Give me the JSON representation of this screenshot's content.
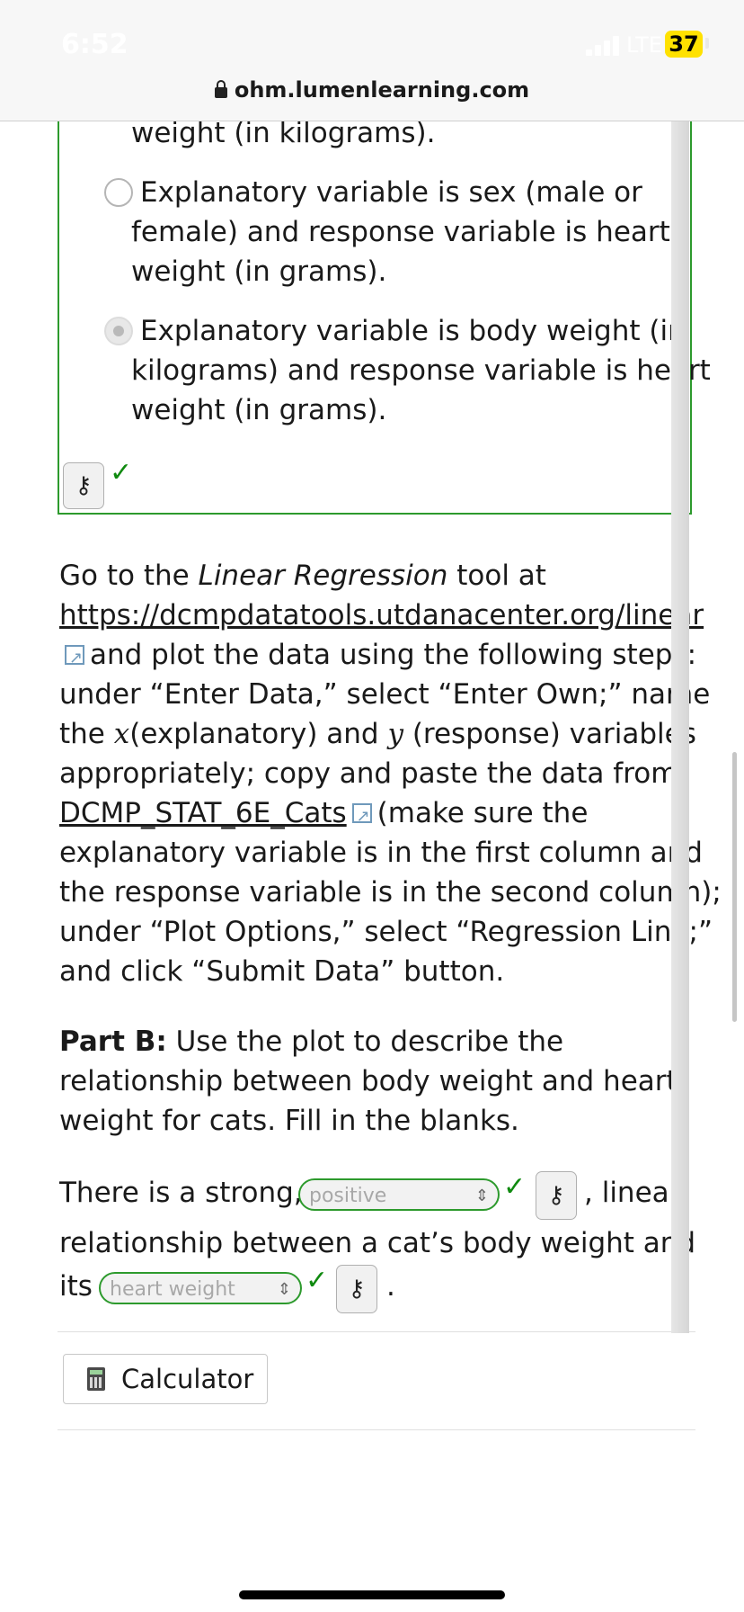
{
  "status_bar": {
    "time": "6:52",
    "network": "LTE",
    "battery": "37"
  },
  "browser": {
    "url": "ohm.lumenlearning.com"
  },
  "question": {
    "prev_option_tail": "weight (in kilograms).",
    "options": [
      {
        "lines": [
          "Explanatory variable is sex (male or",
          "female) and response variable is heart",
          "weight (in grams)."
        ],
        "selected": false
      },
      {
        "lines": [
          "Explanatory variable is body weight (in",
          "kilograms) and response variable is heart",
          "weight (in grams)."
        ],
        "selected": true
      }
    ],
    "answer_key_icon": "key-icon",
    "result": "✓"
  },
  "instructions": {
    "line1_pre": "Go to the ",
    "line1_italic": "Linear Regression",
    "line1_post": " tool at",
    "link_url": "https://dcmpdatatools.utdanacenter.org/linear",
    "line3": "and plot the data using the following steps:",
    "line4": "under “Enter Data,” select “Enter Own;” name",
    "line5_pre": "the ",
    "var_x": "x",
    "line5_mid": "(explanatory) and ",
    "var_y": "y",
    "line5_post": " (response) variables",
    "line6": "appropriately; copy and paste the data from",
    "data_link": "DCMP_STAT_6E_Cats",
    "line7_post": "(make sure the",
    "line8": "explanatory variable is in the first column and",
    "line9": "the response variable is in the second column);",
    "line10": "under “Plot Options,” select “Regression Line;”",
    "line11": "and click “Submit Data” button."
  },
  "part_b": {
    "label": "Part B:",
    "line1": " Use the plot to describe the",
    "line2": "relationship between body weight and heart",
    "line3": "weight for cats. Fill in the blanks."
  },
  "fill": {
    "pre1": "There is a strong,",
    "select1": "positive",
    "post1": ", linear",
    "line2": "relationship between a cat’s body weight and",
    "pre3": "its",
    "select2": "heart weight",
    "post3": "."
  },
  "calculator": {
    "label": "Calculator"
  }
}
